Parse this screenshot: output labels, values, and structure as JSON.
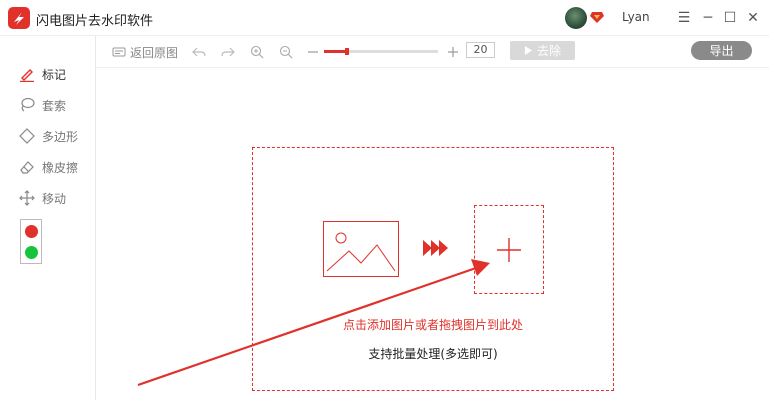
{
  "window": {
    "title": "闪电图片去水印软件",
    "user_name": "Lyan",
    "minimize_symbol": "─",
    "maximize_symbol": "☐",
    "close_symbol": "✕",
    "menu_symbol": "☰"
  },
  "sidebar": {
    "items": [
      {
        "label": "标记",
        "icon": "pen-icon"
      },
      {
        "label": "套索",
        "icon": "lasso-icon"
      },
      {
        "label": "多边形",
        "icon": "polygon-icon"
      },
      {
        "label": "橡皮擦",
        "icon": "eraser-icon"
      },
      {
        "label": "移动",
        "icon": "move-icon"
      }
    ],
    "colors": [
      "#e0312b",
      "#16c43c"
    ]
  },
  "toolbar": {
    "restore_label": "返回原图",
    "zoom_value": "20",
    "zoom_level": 0.2,
    "remove_label": "去除",
    "export_label": "导出"
  },
  "dropzone": {
    "hint": "点击添加图片或者拖拽图片到此处",
    "batch_hint": "支持批量处理(多选即可)"
  },
  "colors": {
    "accent": "#e0312b",
    "export_button": "#8a8a8a",
    "remove_button": "#d9d9d9"
  }
}
